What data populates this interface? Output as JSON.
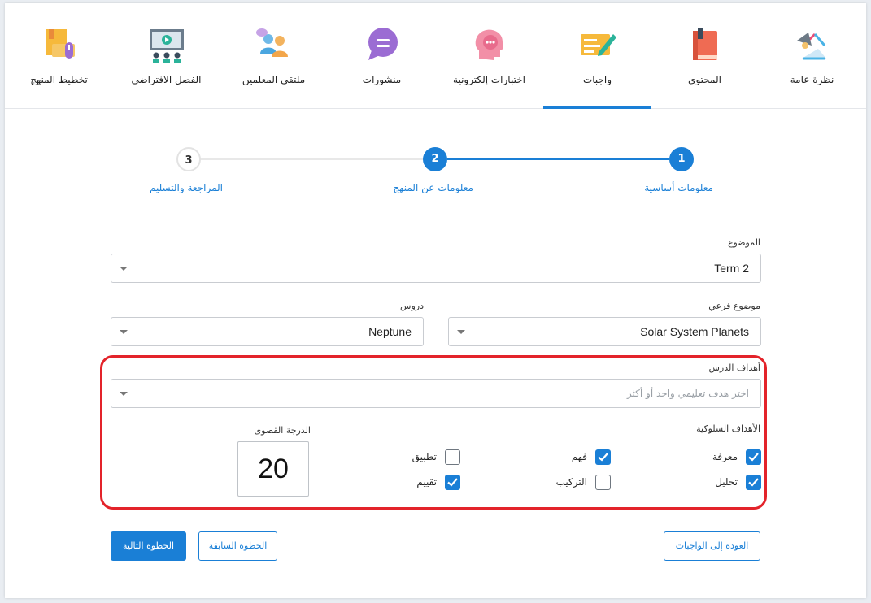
{
  "nav": {
    "items": [
      {
        "label": "نظرة عامة",
        "icon": "lamp-icon"
      },
      {
        "label": "المحتوى",
        "icon": "book-icon"
      },
      {
        "label": "واجبات",
        "icon": "homework-icon"
      },
      {
        "label": "اختبارات إلكترونية",
        "icon": "quiz-head-icon"
      },
      {
        "label": "منشورات",
        "icon": "post-bubble-icon"
      },
      {
        "label": "ملتقى المعلمين",
        "icon": "teachers-forum-icon"
      },
      {
        "label": "الفصل الافتراضي",
        "icon": "virtual-class-icon"
      },
      {
        "label": "تخطيط المنهج",
        "icon": "curriculum-plan-icon"
      }
    ],
    "active": "واجبات"
  },
  "stepper": {
    "steps": [
      {
        "number": "1",
        "label": "معلومات أساسية",
        "state": "done"
      },
      {
        "number": "2",
        "label": "معلومات عن المنهج",
        "state": "current"
      },
      {
        "number": "3",
        "label": "المراجعة والتسليم",
        "state": "pending"
      }
    ]
  },
  "form": {
    "subject": {
      "label": "الموضوع",
      "value": "Term 2"
    },
    "subtopic": {
      "label": "موضوع فرعي",
      "value": "Solar System Planets"
    },
    "lessons": {
      "label": "دروس",
      "value": "Neptune"
    },
    "objectives": {
      "label": "أهداف الدرس",
      "placeholder": "اختر هدف تعليمي واحد أو أكثر"
    },
    "behavioral": {
      "label": "الأهداف السلوكية",
      "options": [
        {
          "label": "معرفة",
          "checked": true
        },
        {
          "label": "فهم",
          "checked": true
        },
        {
          "label": "تطبيق",
          "checked": false
        },
        {
          "label": "تحليل",
          "checked": true
        },
        {
          "label": "التركيب",
          "checked": false
        },
        {
          "label": "تقييم",
          "checked": true
        }
      ]
    },
    "max_score": {
      "label": "الدرجة القصوى",
      "value": "20"
    }
  },
  "buttons": {
    "back": "العودة إلى الواجبات",
    "previous": "الخطوة السابقة",
    "next": "الخطوة التالية"
  },
  "colors": {
    "accent": "#1a7fd6",
    "highlight": "#e3232a"
  }
}
